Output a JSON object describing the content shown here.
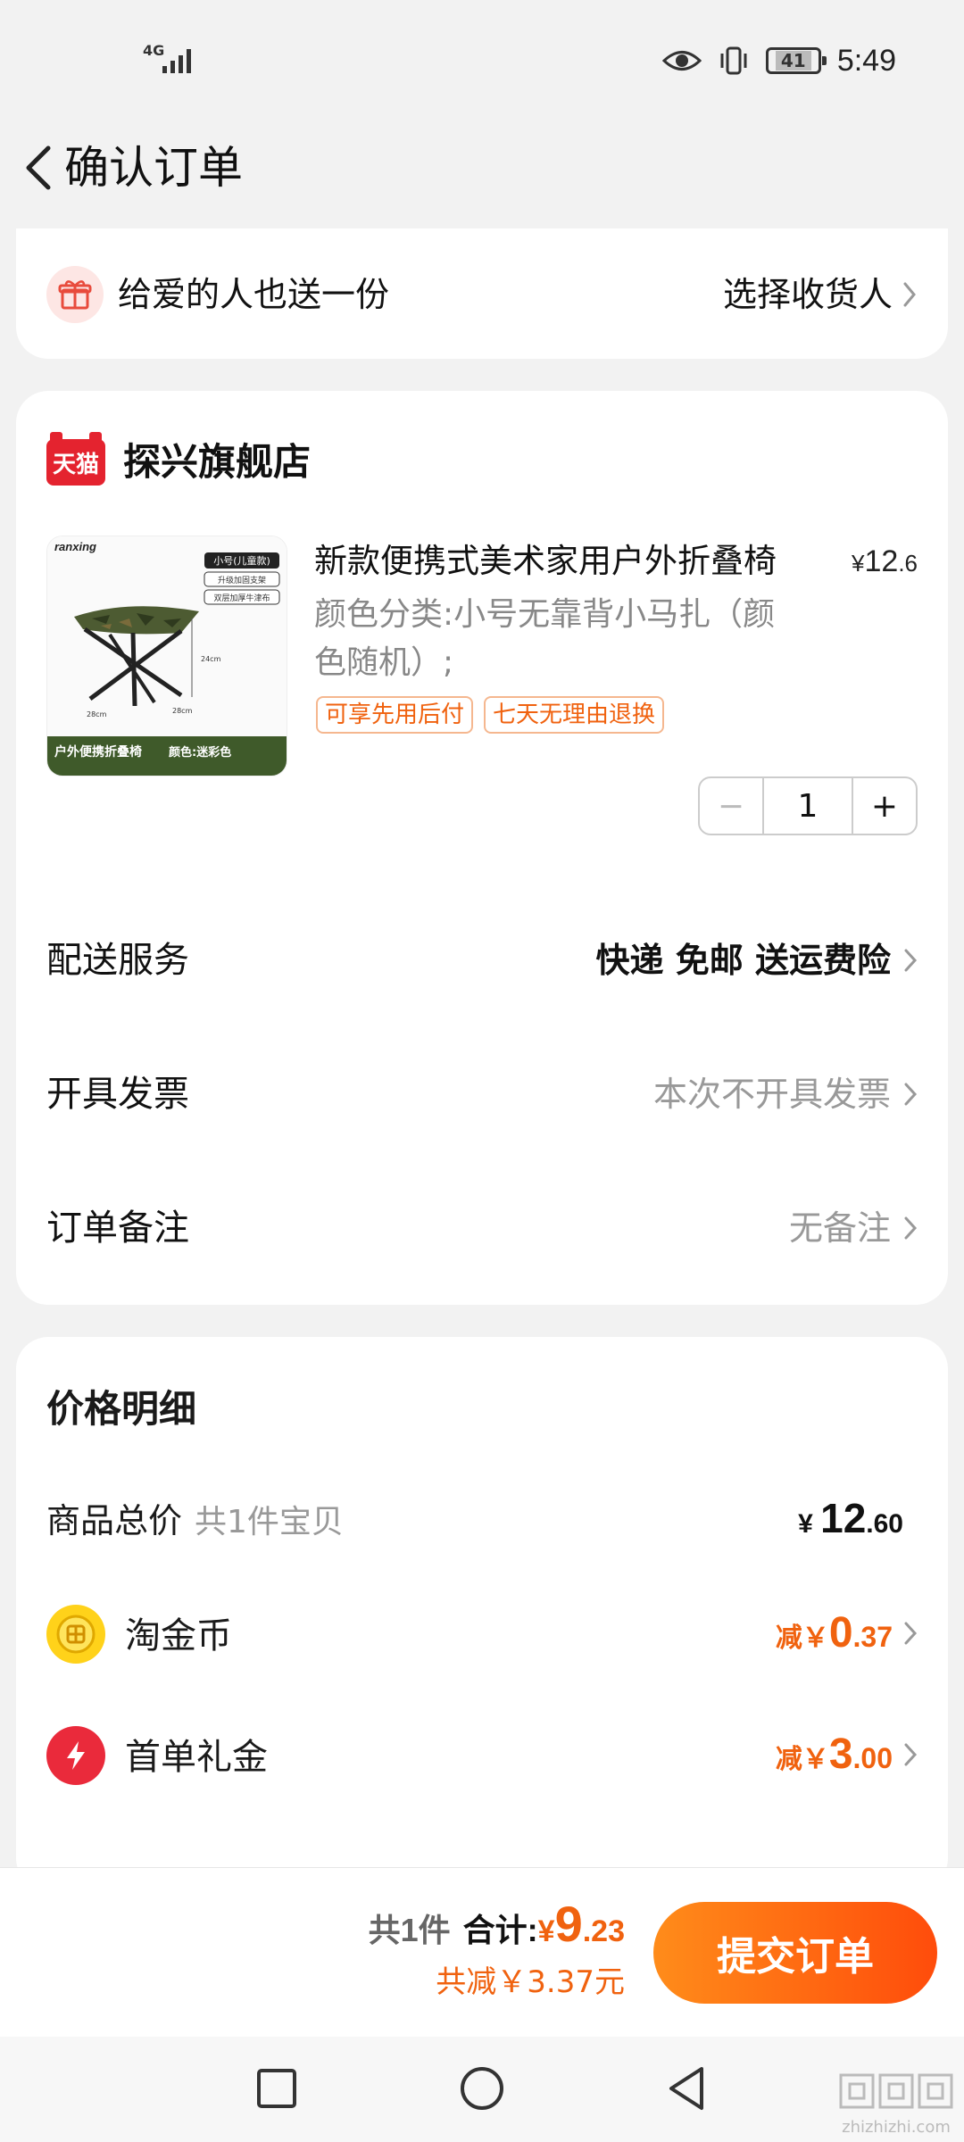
{
  "status_bar": {
    "network": "4G",
    "battery": "41",
    "time": "5:49"
  },
  "header": {
    "title": "确认订单"
  },
  "gift": {
    "text": "给爱的人也送一份",
    "action": "选择收货人"
  },
  "store": {
    "logo_text": "天猫",
    "name": "探兴旗舰店"
  },
  "product": {
    "title": "新款便携式美术家用户外折叠椅",
    "price_symbol": "¥",
    "price_int": "12",
    "price_dec": ".6",
    "spec": "颜色分类:小号无靠背小马扎（颜色随机）;",
    "tags": [
      "可享先用后付",
      "七天无理由退换"
    ],
    "quantity": "1",
    "image_text": {
      "brand": "ranxing",
      "size_label": "小号(儿童款)",
      "feature1": "升级加固支架",
      "feature2": "双层加厚牛津布",
      "dim_h": "24cm",
      "dim_w1": "28cm",
      "dim_w2": "28cm",
      "banner_left": "户外便携折叠椅",
      "banner_right": "颜色:迷彩色"
    }
  },
  "rows": {
    "delivery_label": "配送服务",
    "delivery_value": "快递 免邮 送运费险",
    "invoice_label": "开具发票",
    "invoice_value": "本次不开具发票",
    "note_label": "订单备注",
    "note_value": "无备注"
  },
  "price_detail": {
    "title": "价格明细",
    "goods_total_label": "商品总价",
    "goods_total_sub": "共1件宝贝",
    "goods_total_cur": "¥",
    "goods_total_int": "12",
    "goods_total_dec": ".60",
    "coin_label": "淘金币",
    "coin_pre": "减￥",
    "coin_int": "0",
    "coin_dec": ".37",
    "gift_label": "首单礼金",
    "gift_pre": "减￥",
    "gift_int": "3",
    "gift_dec": ".00"
  },
  "bottom": {
    "count": "共1件",
    "total_label": "合计:",
    "cur": "¥",
    "total_int": "9",
    "total_dec": ".23",
    "discount": "共减￥3.37元",
    "submit": "提交订单"
  },
  "watermark": {
    "text": "zhizhizhi.com"
  },
  "colors": {
    "accent": "#f0620f",
    "tmall_red": "#e4232f",
    "button_gradient_start": "#ff8c1a",
    "button_gradient_end": "#ff4c0b"
  }
}
